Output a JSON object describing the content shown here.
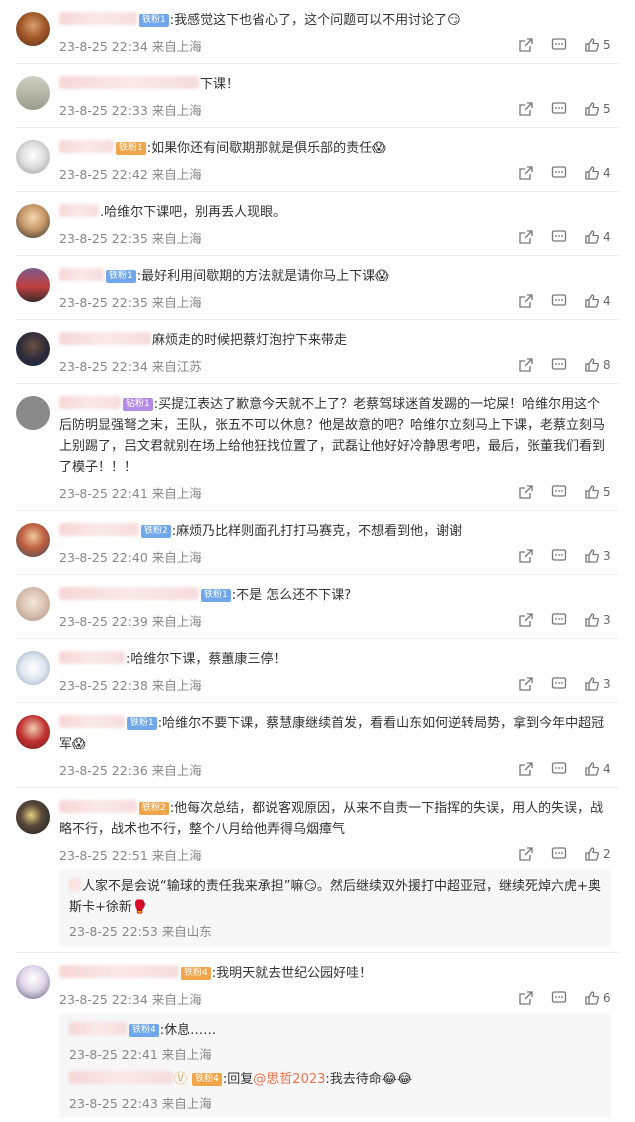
{
  "comments": [
    {
      "text": "我感觉这下也省心了，这个问题可以不用讨论了",
      "badge": "铁粉1",
      "time": "23-8-25 22:34",
      "loc": "来自上海",
      "likes": "5"
    },
    {
      "text": "下课！",
      "badge": "",
      "time": "23-8-25 22:33",
      "loc": "来自上海",
      "likes": "5"
    },
    {
      "text": "如果你还有间歇期那就是俱乐部的责任",
      "badge": "铁粉1",
      "time": "23-8-25 22:42",
      "loc": "来自上海",
      "likes": "4"
    },
    {
      "text": "哈维尔下课吧，别再丢人现眼。",
      "badge": "",
      "time": "23-8-25 22:35",
      "loc": "来自上海",
      "likes": "4"
    },
    {
      "text": "最好利用间歇期的方法就是请你马上下课",
      "badge": "铁粉1",
      "time": "23-8-25 22:35",
      "loc": "来自上海",
      "likes": "4"
    },
    {
      "text": "麻烦走的时候把蔡灯泡拧下来带走",
      "badge": "",
      "time": "23-8-25 22:34",
      "loc": "来自江苏",
      "likes": "8"
    },
    {
      "text": "买提江表达了歉意今天就不上了？老蔡驾球迷首发踢的一坨屎！哈维尔用这个后防明显强弩之末，王队，张五不可以休息？他是故意的吧？哈维尔立刻马上下课，老蔡立刻马上别踢了，吕文君就别在场上给他狂找位置了，武磊让他好好冷静思考吧，最后，张董我们看到了模子！！！",
      "badge": "钻粉1",
      "time": "23-8-25 22:41",
      "loc": "来自上海",
      "likes": "5"
    },
    {
      "text": "麻烦乃比样则面孔打打马赛克，不想看到他，谢谢",
      "badge": "铁粉2",
      "time": "23-8-25 22:40",
      "loc": "来自上海",
      "likes": "3"
    },
    {
      "text": "不是 怎么还不下课?",
      "badge": "铁粉1",
      "time": "23-8-25 22:39",
      "loc": "来自上海",
      "likes": "3"
    },
    {
      "text": "哈维尔下课，蔡蕙康三停！",
      "badge": "",
      "time": "23-8-25 22:38",
      "loc": "来自上海",
      "likes": "3"
    },
    {
      "text": "哈维尔不要下课，蔡慧康继续首发，看看山东如何逆转局势，拿到今年中超冠军",
      "badge": "铁粉1",
      "time": "23-8-25 22:36",
      "loc": "来自上海",
      "likes": "4"
    },
    {
      "text": "他每次总结，都说客观原因，从来不自责一下指挥的失误，用人的失误，战略不行，战术也不行，整个八月给他弄得乌烟瘴气",
      "badge": "铁粉2",
      "time": "23-8-25 22:51",
      "loc": "来自上海",
      "likes": "2",
      "reply": {
        "text": "人家不是会说“输球的责任我来承担”嘛",
        "text2": "。然后继续双外援打中超亚冠，继续死焯六虎+奥斯卡+徐新",
        "time": "23-8-25 22:53",
        "loc": "来自山东"
      }
    },
    {
      "text": "我明天就去世纪公园好哇！",
      "badge": "铁粉4",
      "time": "23-8-25 22:34",
      "loc": "来自上海",
      "likes": "6",
      "replies": [
        {
          "text": "休息……",
          "badge": "铁粉4",
          "time": "23-8-25 22:41",
          "loc": "来自上海"
        },
        {
          "prefix": "回复",
          "mention": "@思哲2023",
          "text": ":我去待命",
          "badge": "铁粉4",
          "time": "23-8-25 22:43",
          "loc": "来自上海"
        }
      ]
    }
  ],
  "icons": {
    "share": "share-icon",
    "comment": "comment-icon",
    "like": "like-icon"
  },
  "colors": {
    "badge_blue": "#6fa7ea",
    "badge_gold": "#f1a54a",
    "badge_purple": "#b58be8",
    "link": "#eb7350",
    "meta": "#888"
  }
}
